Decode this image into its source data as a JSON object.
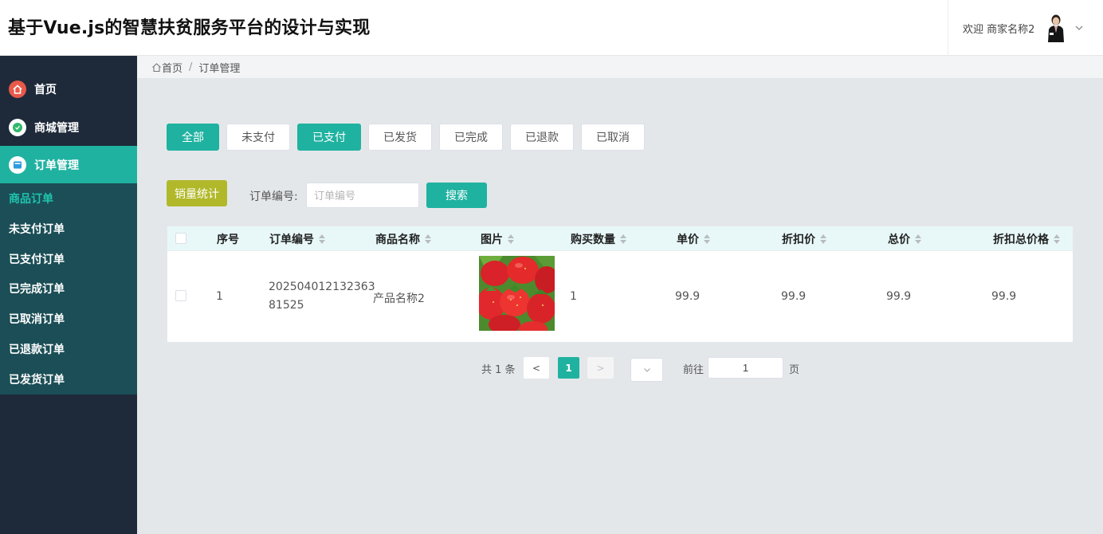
{
  "header": {
    "title": "基于Vue.js的智慧扶贫服务平台的设计与实现",
    "welcome": "欢迎 商家名称2"
  },
  "sidebar": {
    "items": [
      {
        "label": "首页",
        "icon": "home-icon"
      },
      {
        "label": "商城管理",
        "icon": "shop-icon"
      },
      {
        "label": "订单管理",
        "icon": "order-icon",
        "active": true
      }
    ],
    "sub_items": [
      {
        "label": "商品订单",
        "current": true
      },
      {
        "label": "未支付订单"
      },
      {
        "label": "已支付订单"
      },
      {
        "label": "已完成订单"
      },
      {
        "label": "已取消订单"
      },
      {
        "label": "已退款订单"
      },
      {
        "label": "已发货订单"
      }
    ]
  },
  "breadcrumb": {
    "home": "首页",
    "separator": "/",
    "current": "订单管理"
  },
  "status_tabs": [
    {
      "label": "全部",
      "selected": true
    },
    {
      "label": "未支付"
    },
    {
      "label": "已支付",
      "selected": true
    },
    {
      "label": "已发货"
    },
    {
      "label": "已完成"
    },
    {
      "label": "已退款"
    },
    {
      "label": "已取消"
    }
  ],
  "toolbar": {
    "stats_label": "销量统计",
    "order_no_label": "订单编号:",
    "order_no_placeholder": "订单编号",
    "search_label": "搜索"
  },
  "table": {
    "columns": [
      "序号",
      "订单编号",
      "商品名称",
      "图片",
      "购买数量",
      "单价",
      "折扣价",
      "总价",
      "折扣总价格"
    ],
    "rows": [
      {
        "index": "1",
        "order_no_line1": "202504012132363",
        "order_no_line2": "81525",
        "product": "产品名称2",
        "image": "strawberry-photo",
        "quantity": "1",
        "unit_price": "99.9",
        "discount_price": "99.9",
        "total": "99.9",
        "discount_total": "99.9"
      }
    ]
  },
  "pagination": {
    "total": "共 1 条",
    "prev": "<",
    "current_page": "1",
    "next": ">",
    "goto_label": "前往",
    "goto_value": "1",
    "page_unit": "页"
  },
  "colors": {
    "accent": "#20b2a0",
    "sidebar_bg": "#1e2a3a",
    "submenu_bg": "#1b4e56",
    "stats_button": "#b1b92a"
  }
}
